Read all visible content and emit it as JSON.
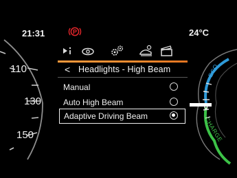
{
  "status": {
    "time": "21:31",
    "temperature": "24°C",
    "parking_brake_icon": "parking-brake-warning-icon",
    "parking_brake_label": "P",
    "warning_color": "#e4262b"
  },
  "speedometer": {
    "ticks": [
      "110",
      "130",
      "150"
    ]
  },
  "power_gauge": {
    "eco_label": "ECO",
    "charge_label": "CHARGE",
    "needle_value": "0",
    "eco_color": "#2e9ad8",
    "charge_color": "#3cc247"
  },
  "menu": {
    "tabs": [
      {
        "icon": "media-play-info-icon",
        "active": false
      },
      {
        "icon": "vehicle-settings-icon",
        "active": false
      },
      {
        "icon": "cogs-settings-icon",
        "active": true
      },
      {
        "icon": "driver-assist-icon",
        "active": false
      },
      {
        "icon": "clapperboard-media-icon",
        "active": false
      }
    ],
    "accent_color": "#f28a2e",
    "back_glyph": "<",
    "title": "Headlights - High Beam",
    "options": [
      {
        "label": "Manual",
        "selected": false
      },
      {
        "label": "Auto High Beam",
        "selected": false
      },
      {
        "label": "Adaptive Driving Beam",
        "selected": true
      }
    ],
    "focused_option_index": 2
  }
}
